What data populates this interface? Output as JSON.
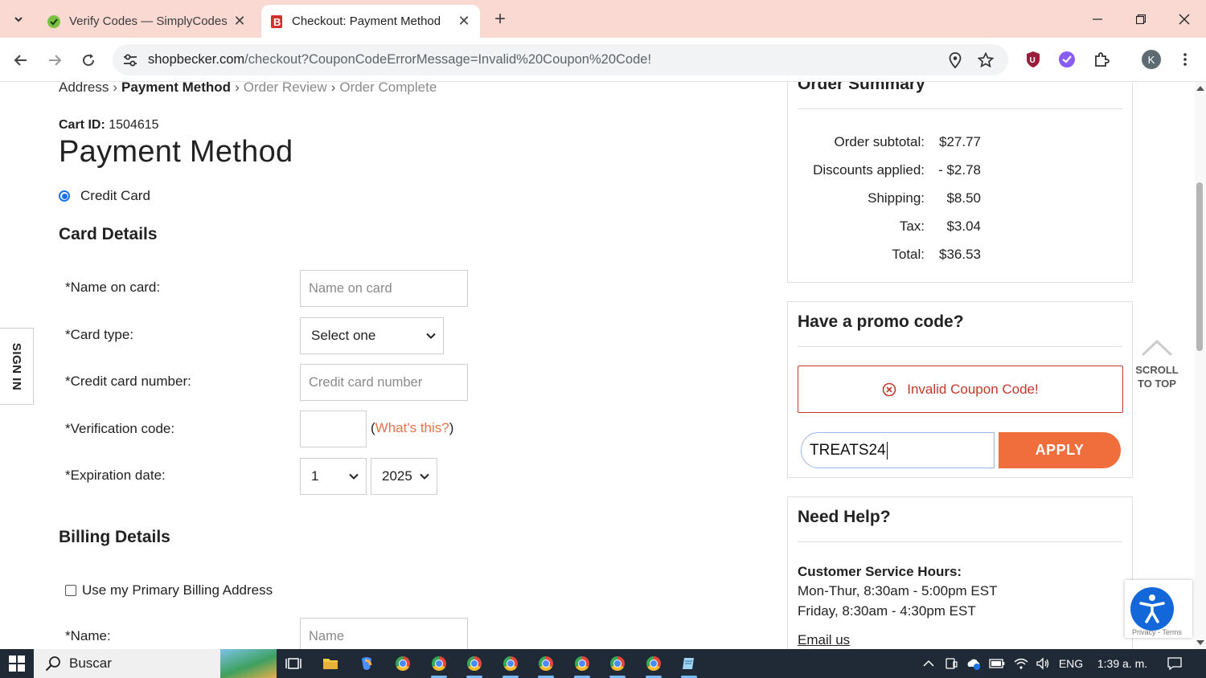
{
  "browser": {
    "tabs": [
      {
        "title": "Verify Codes — SimplyCodes",
        "icon": "simplycodes-favicon"
      },
      {
        "title": "Checkout: Payment Method",
        "icon": "becker-favicon"
      }
    ],
    "url_host": "shopbecker.com",
    "url_path": "/checkout?CouponCodeErrorMessage=Invalid%20Coupon%20Code!",
    "profile_initial": "K"
  },
  "checkout": {
    "breadcrumb": {
      "address": "Address",
      "payment": "Payment Method",
      "review": "Order Review",
      "complete": "Order Complete",
      "separator": "›"
    },
    "cart_id_label": "Cart ID:",
    "cart_id": "1504615",
    "title": "Payment Method",
    "payment_option": "Credit Card",
    "card_details": {
      "heading": "Card Details",
      "name_label": "*Name on card:",
      "name_placeholder": "Name on card",
      "type_label": "*Card type:",
      "type_value": "Select one",
      "number_label": "*Credit card number:",
      "number_placeholder": "Credit card number",
      "cvv_label": "*Verification code:",
      "whats_this": "What's this?",
      "paren_open": "(",
      "paren_close": ")",
      "exp_label": "*Expiration date:",
      "exp_month": "1",
      "exp_year": "2025"
    },
    "billing": {
      "heading": "Billing Details",
      "use_primary": "Use my Primary Billing Address",
      "name_label": "*Name:",
      "name_placeholder": "Name"
    }
  },
  "order_summary": {
    "heading": "Order Summary",
    "rows": [
      {
        "label": "Order subtotal:",
        "value": "$27.77"
      },
      {
        "label": "Discounts applied:",
        "value": "- $2.78"
      },
      {
        "label": "Shipping:",
        "value": "$8.50"
      },
      {
        "label": "Tax:",
        "value": "$3.04"
      },
      {
        "label": "Total:",
        "value": "$36.53"
      }
    ]
  },
  "promo": {
    "heading": "Have a promo code?",
    "error": "Invalid Coupon Code!",
    "code_value": "TREATS24",
    "apply_label": "APPLY"
  },
  "help": {
    "heading": "Need Help?",
    "hours_label": "Customer Service Hours:",
    "line1": "Mon-Thur, 8:30am - 5:00pm EST",
    "line2": "Friday, 8:30am - 4:30pm EST",
    "email": "Email us"
  },
  "widgets": {
    "scroll_top": [
      "SCROLL",
      "TO TOP"
    ],
    "sign_in": "SIGN IN",
    "recaptcha": "Privacy - Terms"
  },
  "taskbar": {
    "search_label": "Buscar",
    "language": "ENG",
    "time": "1:39 a. m."
  },
  "colors": {
    "accent_orange": "#ef6e3b",
    "error_red": "#c0392b",
    "link_orange": "#e8734a",
    "tabstrip": "#f9d9d2"
  }
}
